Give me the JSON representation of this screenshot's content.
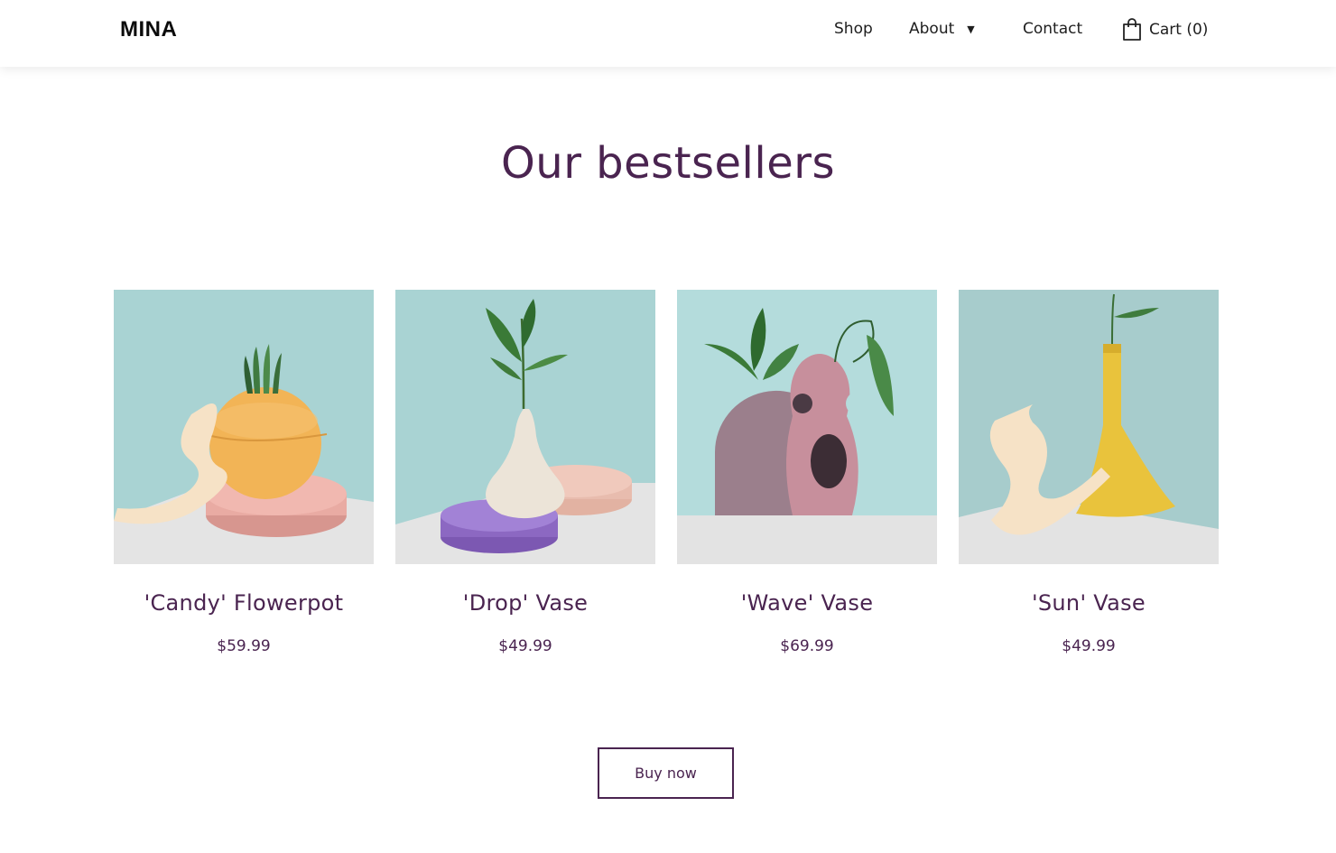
{
  "header": {
    "logo": "MINA",
    "nav": {
      "shop": "Shop",
      "about": "About",
      "contact": "Contact",
      "cart": "Cart (0)"
    }
  },
  "main": {
    "title": "Our bestsellers",
    "products": [
      {
        "name": "'Candy' Flowerpot",
        "price": "$59.99"
      },
      {
        "name": "'Drop' Vase",
        "price": "$49.99"
      },
      {
        "name": "'Wave' Vase",
        "price": "$69.99"
      },
      {
        "name": "'Sun' Vase",
        "price": "$49.99"
      }
    ],
    "buy_button": "Buy now"
  },
  "colors": {
    "accent": "#4a2450",
    "background": "#ffffff",
    "photo_wall": "#a9d3d3",
    "photo_floor": "#e4e4e4"
  },
  "icons": {
    "cart": "shopping-bag-icon",
    "about_dropdown": "caret-down-icon"
  }
}
